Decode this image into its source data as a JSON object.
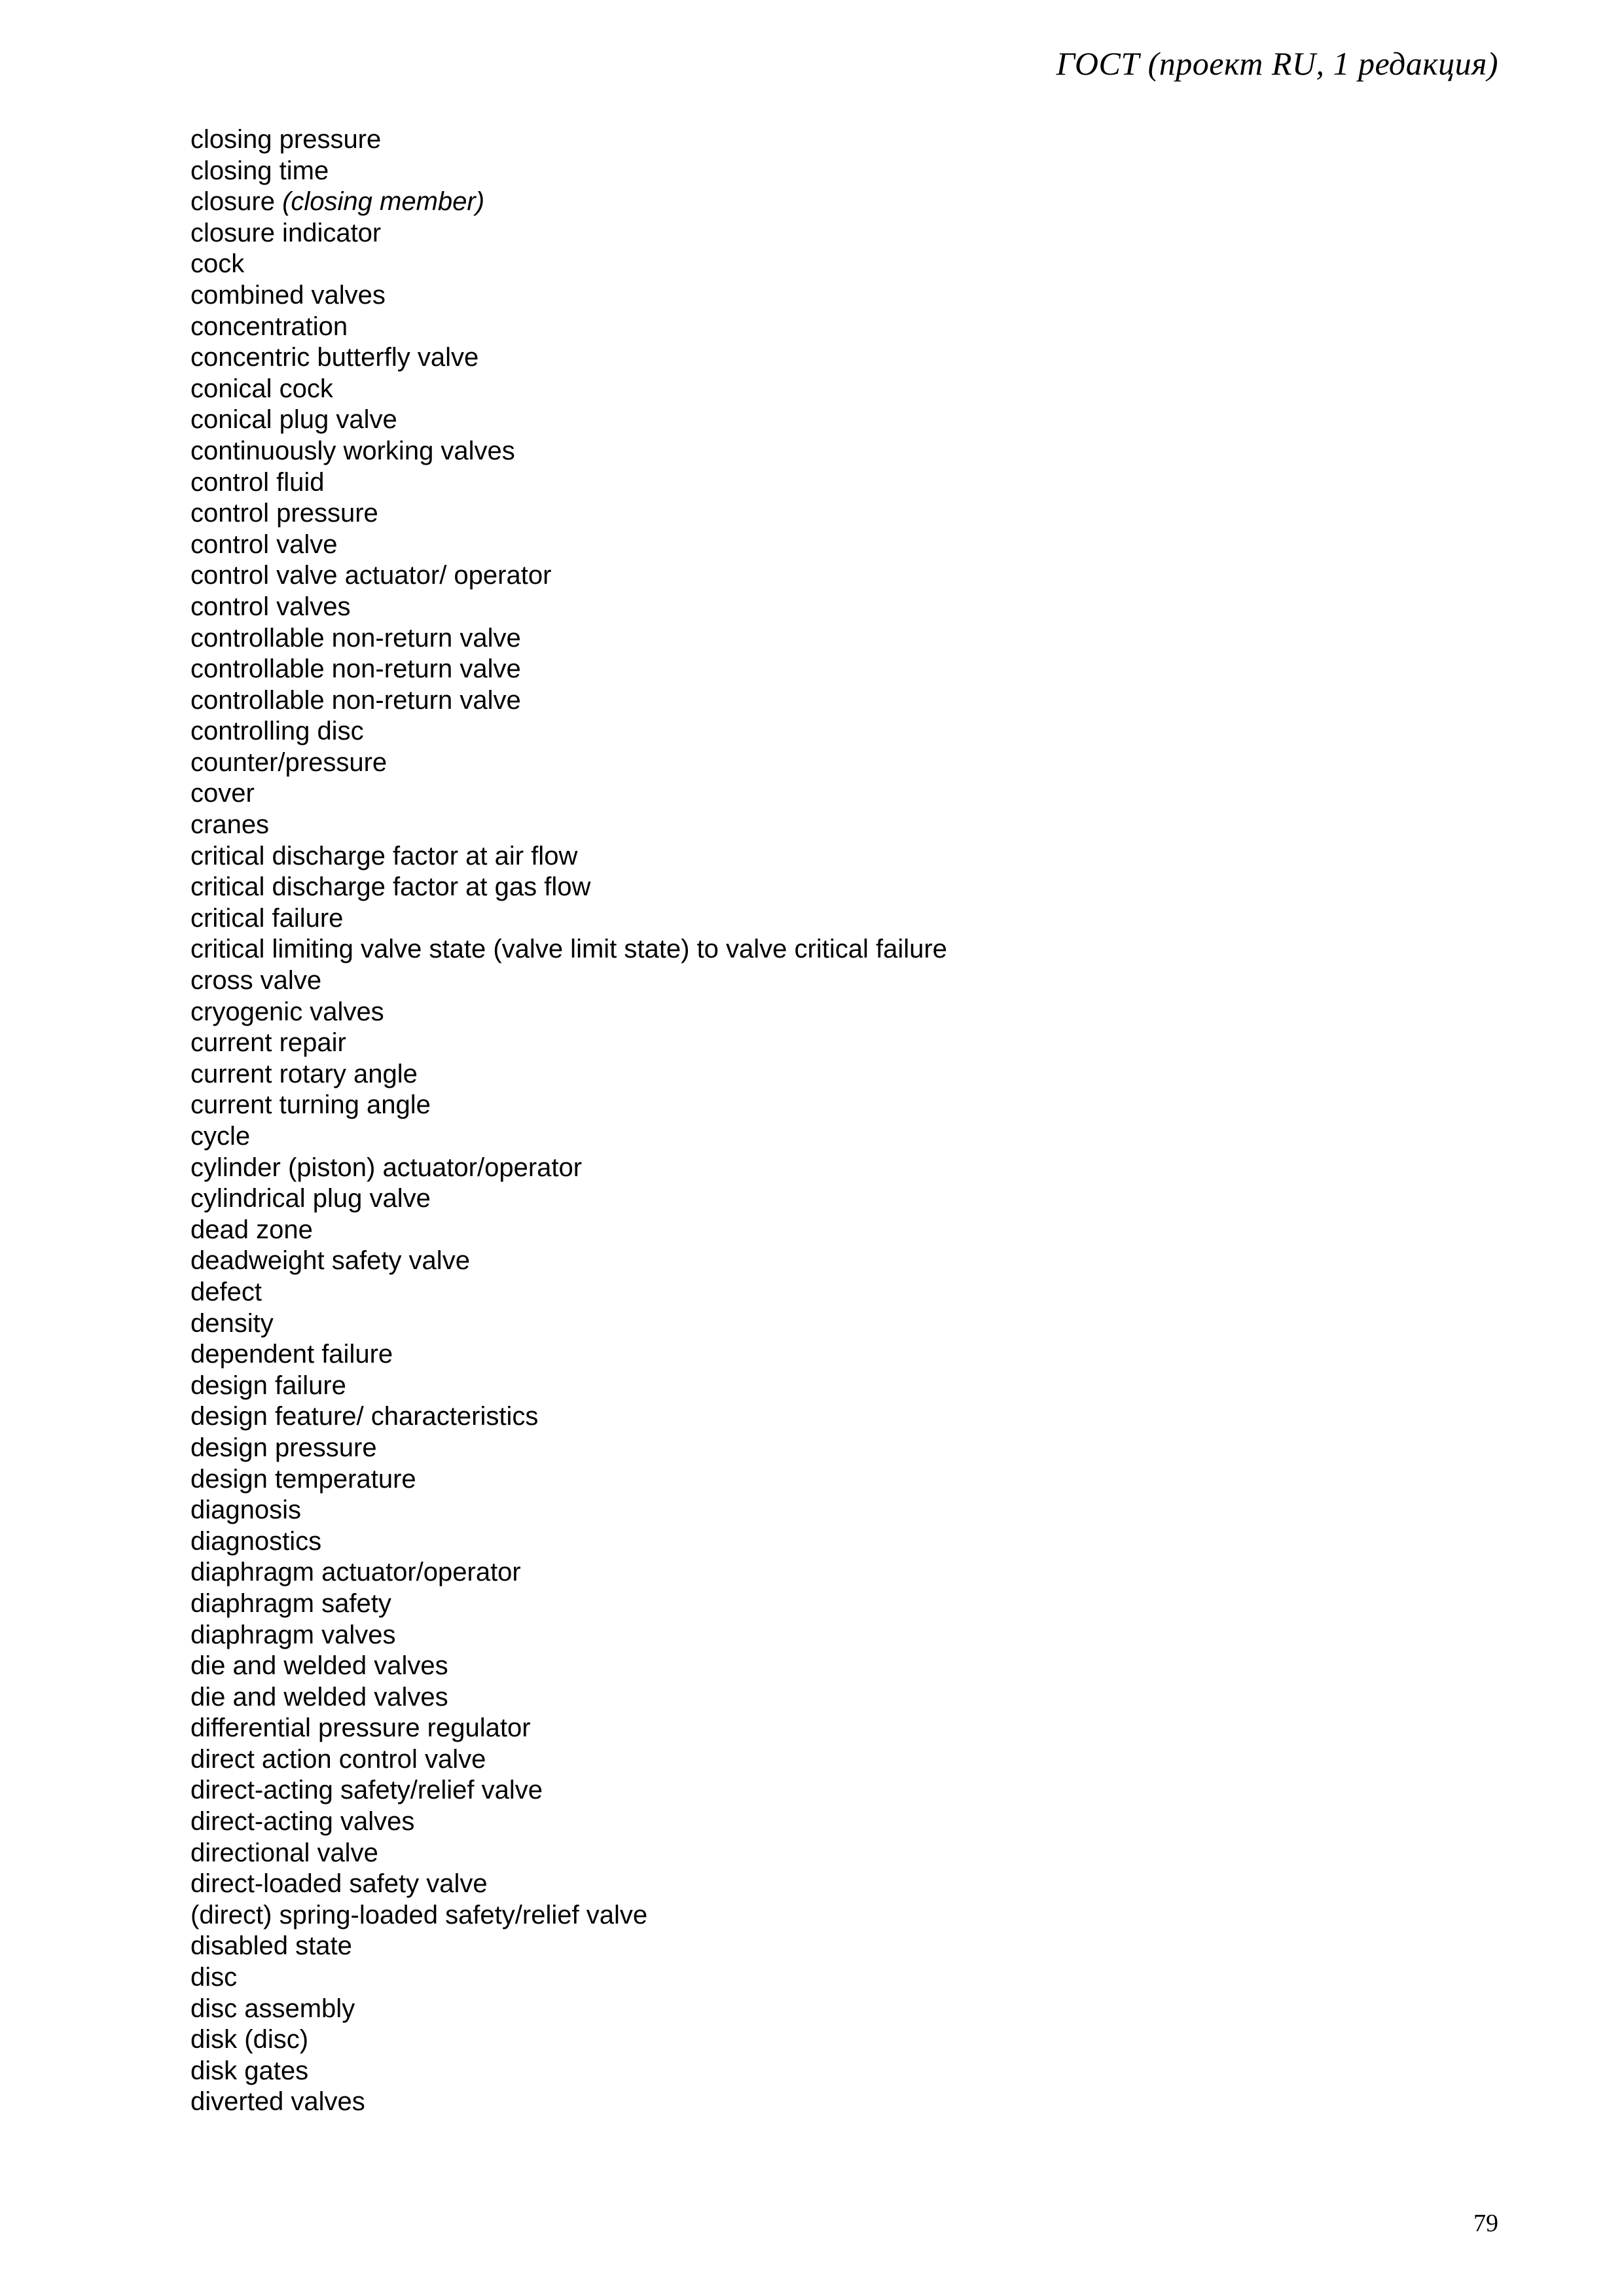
{
  "header": {
    "running_title": "ГОСТ  (проект RU, 1 редакция)"
  },
  "footer": {
    "page_number": "79"
  },
  "glossary": {
    "entries": [
      {
        "text": "closing pressure"
      },
      {
        "text": "closing time"
      },
      {
        "text": "closure ",
        "italic_suffix": "(closing member)"
      },
      {
        "text": "closure indicator"
      },
      {
        "text": "cock"
      },
      {
        "text": "combined valves"
      },
      {
        "text": "concentration"
      },
      {
        "text": "concentric butterfly valve"
      },
      {
        "text": "conical cock"
      },
      {
        "text": "conical plug valve"
      },
      {
        "text": "continuously working valves"
      },
      {
        "text": "control fluid"
      },
      {
        "text": "control pressure"
      },
      {
        "text": "control valve"
      },
      {
        "text": "control valve actuator/ operator"
      },
      {
        "text": "control valves"
      },
      {
        "text": "controllable non-return valve"
      },
      {
        "text": "controllable non-return valve"
      },
      {
        "text": "controllable non-return valve"
      },
      {
        "text": "controlling disc"
      },
      {
        "text": "counter/pressure"
      },
      {
        "text": "cover"
      },
      {
        "text": "cranes"
      },
      {
        "text": "critical discharge factor at air flow"
      },
      {
        "text": "critical discharge factor at gas flow"
      },
      {
        "text": "critical failure"
      },
      {
        "text": "critical limiting valve state (valve limit state) to valve critical failure"
      },
      {
        "text": "cross valve"
      },
      {
        "text": "cryogenic valves"
      },
      {
        "text": "current repair"
      },
      {
        "text": "current rotary angle"
      },
      {
        "text": "current turning angle"
      },
      {
        "text": "cycle"
      },
      {
        "text": "cylinder (piston) actuator/operator"
      },
      {
        "text": "cylindrical plug valve"
      },
      {
        "text": "dead zone"
      },
      {
        "text": "deadweight safety valve"
      },
      {
        "text": "defect"
      },
      {
        "text": "density"
      },
      {
        "text": "dependent failure"
      },
      {
        "text": "design failure"
      },
      {
        "text": "design feature/ characteristics"
      },
      {
        "text": "design pressure"
      },
      {
        "text": "design temperature"
      },
      {
        "text": "diagnosis"
      },
      {
        "text": "diagnostics"
      },
      {
        "text": "diaphragm actuator/operator"
      },
      {
        "text": "diaphragm safety"
      },
      {
        "text": "diaphragm valves"
      },
      {
        "text": "die and welded valves"
      },
      {
        "text": "die and welded valves"
      },
      {
        "text": "differential pressure regulator"
      },
      {
        "text": "direct action control valve"
      },
      {
        "text": "direct-acting safety/relief valve"
      },
      {
        "text": "direct-acting valves"
      },
      {
        "text": "directional valve"
      },
      {
        "text": "direct-loaded safety valve"
      },
      {
        "text": "(direct) spring-loaded safety/relief valve"
      },
      {
        "text": "disabled state"
      },
      {
        "text": "disc"
      },
      {
        "text": "disc assembly"
      },
      {
        "text": "disk (disc)"
      },
      {
        "text": "disk gates"
      },
      {
        "text": "diverted valves"
      }
    ]
  }
}
